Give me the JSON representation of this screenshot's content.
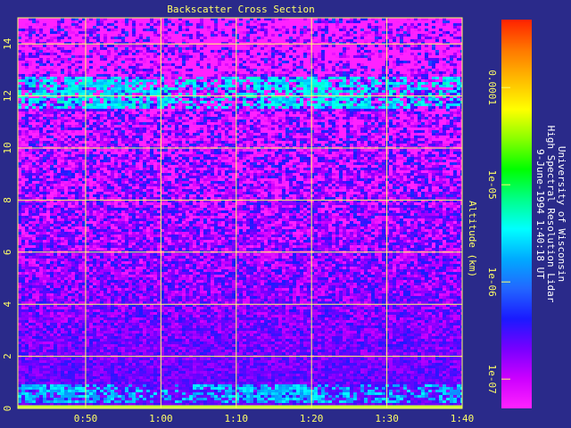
{
  "chart_data": {
    "type": "heatmap",
    "title": "Backscatter Cross Section",
    "xlabel": "",
    "ylabel": "Altitude (km)",
    "x_tick_labels": [
      "0:50",
      "1:00",
      "1:10",
      "1:20",
      "1:30",
      "1:40"
    ],
    "xlim": [
      "0:41",
      "1:40"
    ],
    "y_ticks": [
      0,
      2,
      4,
      6,
      8,
      10,
      12,
      14
    ],
    "ylim": [
      0,
      15
    ],
    "grid": true,
    "colorbar": {
      "scale": "log",
      "range": [
        5e-08,
        0.0005
      ],
      "ticks": [
        {
          "value": 1e-07,
          "label": "1e-07"
        },
        {
          "value": 1e-06,
          "label": "1e-06"
        },
        {
          "value": 1e-05,
          "label": "1e-05"
        },
        {
          "value": 0.0001,
          "label": "0.0001"
        }
      ],
      "colors": [
        "#ff22ff",
        "#cc00ff",
        "#7700ff",
        "#1a1aff",
        "#2266ff",
        "#00aaff",
        "#00ffff",
        "#00ff88",
        "#00ff00",
        "#88ff00",
        "#ffff00",
        "#ffbb00",
        "#ff7700",
        "#ff2200"
      ]
    },
    "layers": [
      {
        "altitude_km": [
          0.2,
          0.9
        ],
        "backscatter": 2e-06
      },
      {
        "altitude_km": [
          11.5,
          12.7
        ],
        "backscatter": 3e-06
      }
    ]
  },
  "annotation": {
    "lines": [
      "University of Wisconsin",
      "High Spectral Resolution Lidar",
      "9-June-1994  1:40:18 UT"
    ]
  },
  "colors": {
    "background": "#2a2a8a",
    "grid": "#ffff66",
    "text": "#ffff66",
    "annotation_text": "#ffffff"
  }
}
